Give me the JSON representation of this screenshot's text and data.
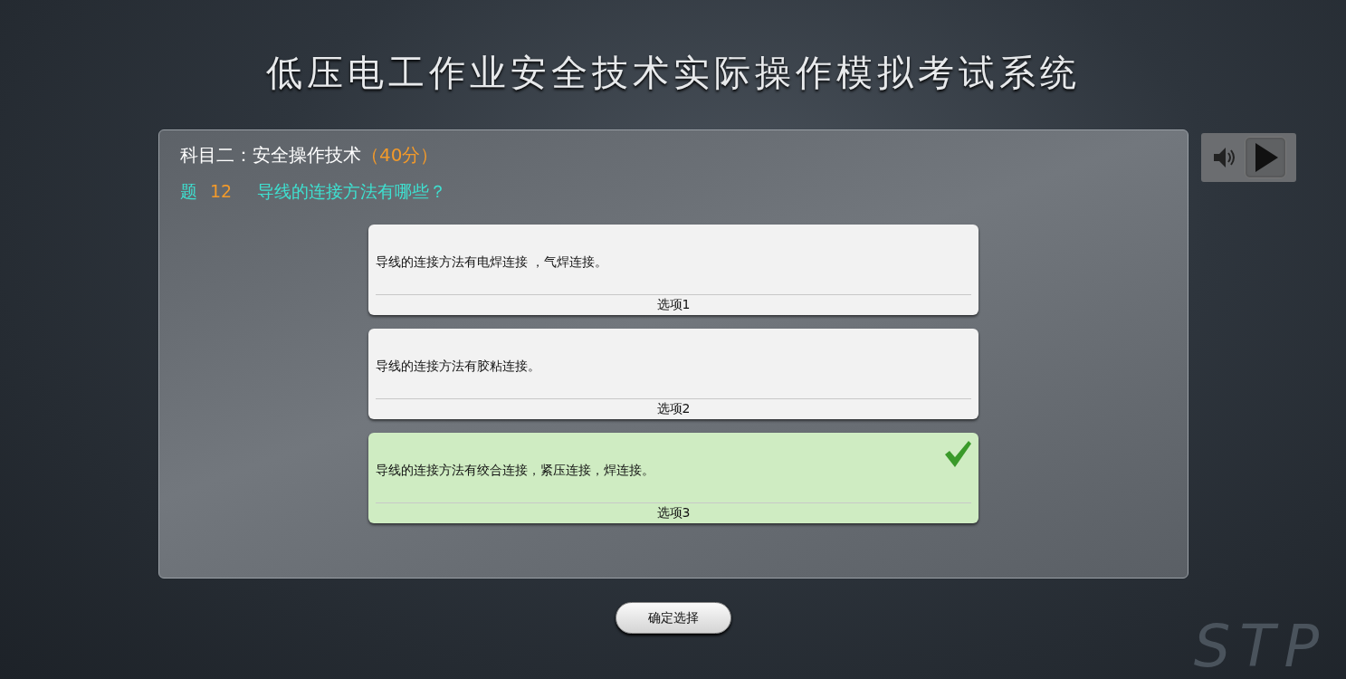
{
  "title": "低压电工作业安全技术实际操作模拟考试系统",
  "subject": {
    "label": "科目二：安全操作技术",
    "score": "（40分）"
  },
  "question": {
    "prefix": "题",
    "number": "12",
    "text": "导线的连接方法有哪些？"
  },
  "options": [
    {
      "text": "导线的连接方法有电焊连接 ，气焊连接。",
      "label": "选项1",
      "selected": false
    },
    {
      "text": "导线的连接方法有胶粘连接。",
      "label": "选项2",
      "selected": false
    },
    {
      "text": "导线的连接方法有绞合连接，紧压连接，焊连接。",
      "label": "选项3",
      "selected": true
    }
  ],
  "confirm_button": "确定选择",
  "logo": "STP"
}
